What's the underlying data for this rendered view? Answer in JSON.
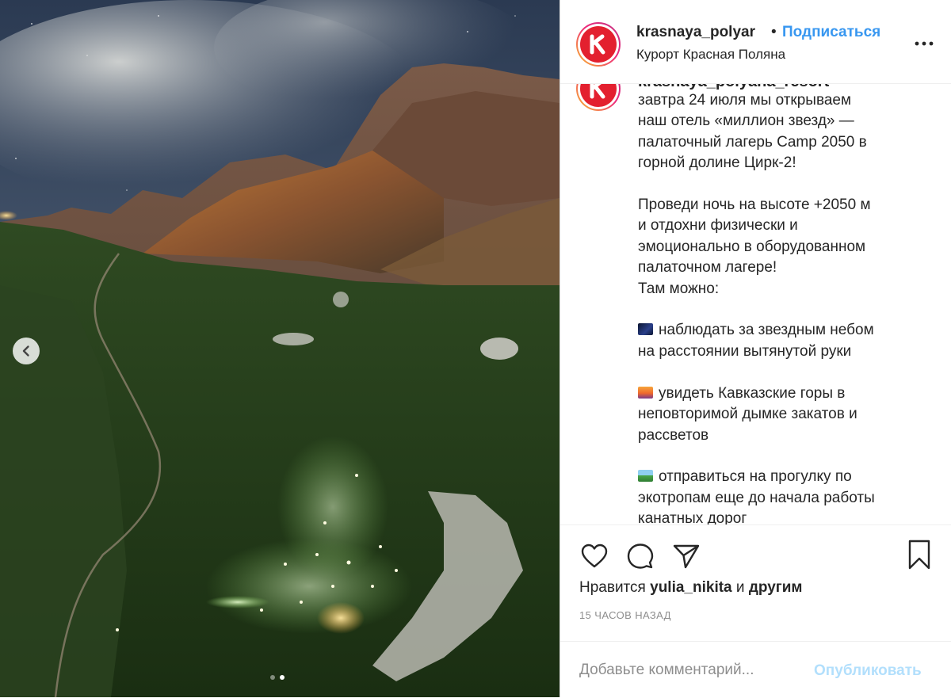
{
  "photo": {
    "description_icon": "mountain-night-photo",
    "prev_icon": "chevron-left-icon",
    "carousel": {
      "count": 2,
      "active_index": 1
    }
  },
  "header": {
    "username": "krasnaya_polyar",
    "separator": "•",
    "follow_label": "Подписаться",
    "location": "Курорт Красная Поляна",
    "avatar_letter": "K",
    "more_icon": "more-horizontal-icon"
  },
  "caption": {
    "username_partial": "krasnaya_polyana_resort",
    "lines": [
      "завтра 24 июля мы открываем",
      "наш отель «миллион звезд» —",
      "палаточный лагерь Camp 2050 в",
      "горной долине Цирк-2!",
      "",
      "Проведи ночь на высоте +2050 м",
      "и отдохни физически и",
      "эмоционально в оборудованном",
      "палаточном лагере!",
      "Там можно:",
      ""
    ],
    "items": [
      {
        "emoji": "night-sky-emoji",
        "lines": [
          "наблюдать за звездным небом",
          "на расстоянии вытянутой руки"
        ]
      },
      {
        "emoji": "sunset-emoji",
        "lines": [
          "увидеть Кавказские горы в",
          "неповторимой дымке закатов и",
          "рассветов"
        ]
      },
      {
        "emoji": "landscape-emoji",
        "lines": [
          "отправиться на прогулку по",
          "экотропам еще до начала работы",
          "канатных дорог"
        ]
      }
    ]
  },
  "actions": {
    "icons": [
      "heart-icon",
      "comment-icon",
      "share-icon",
      "bookmark-icon"
    ],
    "likes_prefix": "Нравится",
    "likes_user": "yulia_nikita",
    "likes_and": "и",
    "likes_others": "другим",
    "timestamp": "15 ЧАСОВ НАЗАД"
  },
  "comment": {
    "placeholder": "Добавьте комментарий...",
    "publish_label": "Опубликовать"
  },
  "colors": {
    "accent_blue": "#3897f0",
    "publish_disabled": "#b2dffc",
    "brand_red": "#e3202f",
    "muted": "#8e8e8e"
  }
}
